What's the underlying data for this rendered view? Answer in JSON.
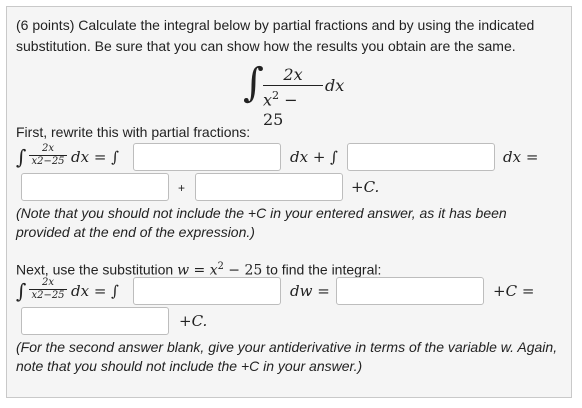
{
  "problem": {
    "line1": "(6 points) Calculate the integral below by partial fractions and by using the indicated",
    "line2": "substitution. Be sure that you can show how the results you obtain are the same."
  },
  "display_integral": {
    "numerator": "2x",
    "denominator_base": "x",
    "denominator_exp": "2",
    "denominator_rest": " − 25",
    "dx": "dx"
  },
  "partial": {
    "prompt": "First, rewrite this with partial fractions:",
    "small_num": "2x",
    "small_den": "x2−25",
    "dx_eq": "dx =",
    "integral_sign": "∫",
    "dx_plus": "dx + ∫",
    "dx_eq2": "dx =",
    "plus": "+",
    "plus_c": "+C.",
    "note1": "(Note that you should not include the +C in your entered answer, as it has been",
    "note2": "provided at the end of the expression.)"
  },
  "substitution": {
    "prompt_pre": "Next, use the substitution ",
    "prompt_eq": "w = x",
    "prompt_exp": "2",
    "prompt_rest": " − 25",
    "prompt_post": " to find the integral:",
    "dx_eq": "dx = ∫",
    "dw_eq": "dw =",
    "plus_c_eq": "+C =",
    "plus_c": "+C.",
    "note1": "(For the second answer blank, give your antiderivative in terms of the variable w. Again,",
    "note2": "note that you should not include the +C in your answer.)"
  },
  "inputs": {
    "pf_first": "",
    "pf_second": "",
    "pf_term1": "",
    "pf_term2": "",
    "sub_first": "",
    "sub_second": "",
    "sub_final": ""
  }
}
